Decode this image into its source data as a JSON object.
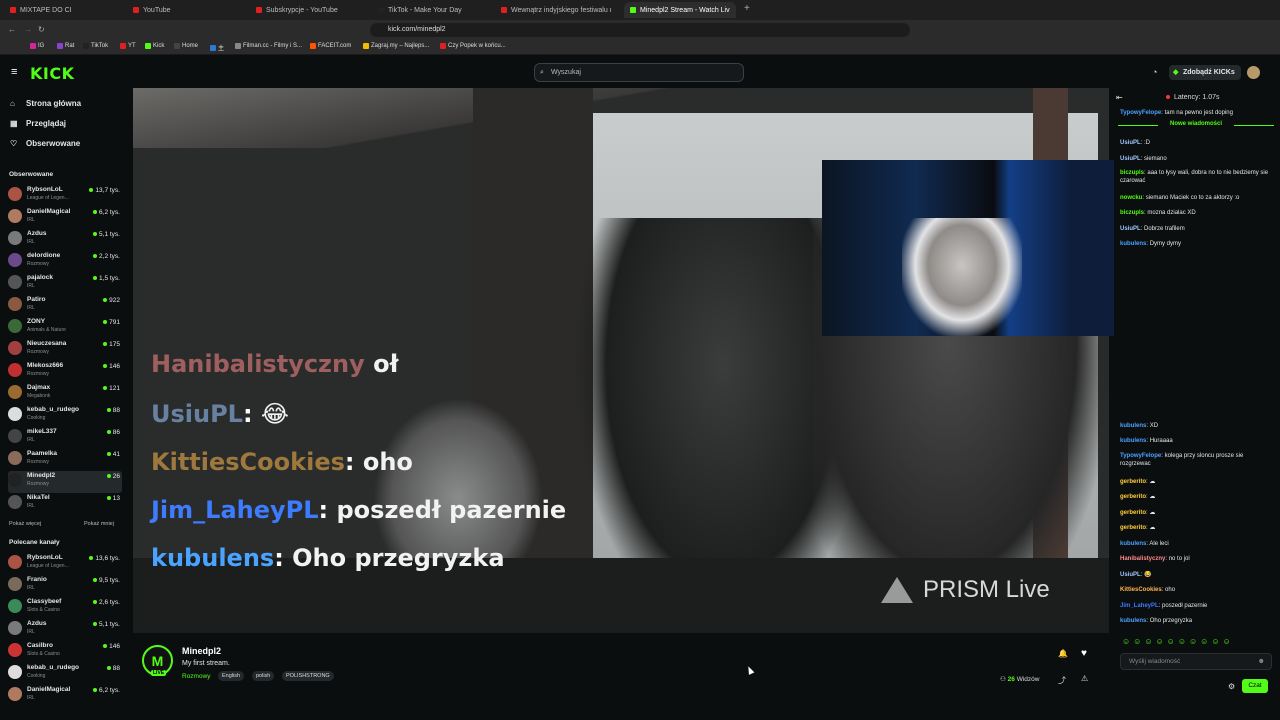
{
  "browser": {
    "tabs": [
      {
        "label": "MIXTAPE DO CI",
        "color": "#e02020"
      },
      {
        "label": "YouTube",
        "color": "#e02020"
      },
      {
        "label": "Subskrypcje - YouTube",
        "color": "#e02020"
      },
      {
        "label": "TikTok - Make Your Day",
        "color": "#222222"
      },
      {
        "label": "Wewnątrz indyjskiego festiwalu rzuc",
        "color": "#e02020"
      },
      {
        "label": "Minedpl2 Stream - Watch Liv",
        "color": "#53fc18"
      }
    ],
    "new_tab": "+",
    "url": "kick.com/minedpl2",
    "bookmarks": [
      {
        "label": "IG",
        "color": "#d6249f"
      },
      {
        "label": "Rat",
        "color": "#8844cc"
      },
      {
        "label": "TikTok",
        "color": "#222222"
      },
      {
        "label": "YT",
        "color": "#e02020"
      },
      {
        "label": "Kick",
        "color": "#53fc18"
      },
      {
        "label": "Home",
        "color": "#444444"
      },
      {
        "label": "主",
        "color": "#2a7ad6"
      },
      {
        "label": "Filman.cc - Filmy i S...",
        "color": "#888888"
      },
      {
        "label": "FACEIT.com",
        "color": "#ff5500"
      },
      {
        "label": "Zagraj.my – Najleps...",
        "color": "#f0c000"
      },
      {
        "label": "Czy Popek w końcu...",
        "color": "#e02020"
      }
    ]
  },
  "kick": {
    "logo": "KICK",
    "search_placeholder": "Wyszukaj",
    "get_kicks": "Zdobądź KICKs"
  },
  "sidebar": {
    "nav": [
      {
        "label": "Strona główna",
        "icon": "home-icon"
      },
      {
        "label": "Przeglądaj",
        "icon": "browse-icon"
      },
      {
        "label": "Obserwowane",
        "icon": "heart-icon"
      }
    ],
    "following_title": "Obserwowane",
    "following": [
      {
        "name": "RybsonLoL",
        "cat": "League of Legen...",
        "viewers": "13,7 tys.",
        "color": "#aa5544"
      },
      {
        "name": "DanielMagical",
        "cat": "IRL",
        "viewers": "6,2 tys.",
        "color": "#b07a60"
      },
      {
        "name": "Azdus",
        "cat": "IRL",
        "viewers": "5,1 tys.",
        "color": "#7a7a7a"
      },
      {
        "name": "delordione",
        "cat": "Rozmowy",
        "viewers": "2,2 tys.",
        "color": "#6a4a8a"
      },
      {
        "name": "pajalock",
        "cat": "IRL",
        "viewers": "1,5 tys.",
        "color": "#555555"
      },
      {
        "name": "Patiro",
        "cat": "IRL",
        "viewers": "922",
        "color": "#8a5a40"
      },
      {
        "name": "ZONY",
        "cat": "Animals & Nature",
        "viewers": "791",
        "color": "#3a6a3a"
      },
      {
        "name": "Nieuczesana",
        "cat": "Rozmowy",
        "viewers": "175",
        "color": "#a04040"
      },
      {
        "name": "Mlekosz666",
        "cat": "Rozmowy",
        "viewers": "146",
        "color": "#c03030"
      },
      {
        "name": "Dajmax",
        "cat": "Megabonk",
        "viewers": "121",
        "color": "#9a6a30"
      },
      {
        "name": "kebab_u_rudego",
        "cat": "Cooking",
        "viewers": "88",
        "color": "#dddddd"
      },
      {
        "name": "mikeL337",
        "cat": "IRL",
        "viewers": "86",
        "color": "#444444"
      },
      {
        "name": "Paamelka",
        "cat": "Rozmowy",
        "viewers": "41",
        "color": "#8a6a5a"
      },
      {
        "name": "Minedpl2",
        "cat": "Rozmowy",
        "viewers": "26",
        "color": "#222222"
      },
      {
        "name": "NikaTel",
        "cat": "IRL",
        "viewers": "13",
        "color": "#555555"
      }
    ],
    "show_more": "Pokaż więcej",
    "show_less": "Pokaż mniej",
    "recommended_title": "Polecane kanały",
    "recommended": [
      {
        "name": "RybsonLoL",
        "cat": "League of Legen...",
        "viewers": "13,6 tys.",
        "color": "#aa5544"
      },
      {
        "name": "Franio",
        "cat": "IRL",
        "viewers": "9,5 tys.",
        "color": "#7a6a5a"
      },
      {
        "name": "Classybeef",
        "cat": "Slots & Casino",
        "viewers": "2,6 tys.",
        "color": "#3a8a5a"
      },
      {
        "name": "Azdus",
        "cat": "IRL",
        "viewers": "5,1 tys.",
        "color": "#7a7a7a"
      },
      {
        "name": "Casilbro",
        "cat": "Slots & Casino",
        "viewers": "146",
        "color": "#cc3333"
      },
      {
        "name": "kebab_u_rudego",
        "cat": "Cooking",
        "viewers": "88",
        "color": "#dddddd"
      },
      {
        "name": "DanielMagical",
        "cat": "IRL",
        "viewers": "6,2 tys.",
        "color": "#b07a60"
      }
    ]
  },
  "video_overlay": [
    {
      "user": "Hanibalistyczny",
      "text": "oł",
      "color": "#ff8a8a"
    },
    {
      "user": "UsiuPL",
      "text": "😂",
      "color": "#9ec7ff"
    },
    {
      "user": "KittiesCookies",
      "text": "oho",
      "color": "#ffb74d"
    },
    {
      "user": "Jim_LaheyPL",
      "text": "poszedł pazernie",
      "color": "#3d7bff"
    },
    {
      "user": "kubulens",
      "text": "Oho przegryzka",
      "color": "#4aa3ff"
    }
  ],
  "prism_logo": "PRISM Live",
  "stream": {
    "avatar_letter": "M",
    "live": "LIVE",
    "streamer": "Minedpl2",
    "title": "My first stream.",
    "category": "Rozmowy",
    "tags": [
      "English",
      "polish",
      "POLISHSTRONG"
    ],
    "viewers_count": "26",
    "viewers_label": "Widzów"
  },
  "chat": {
    "latency": "Latency: 1.07s",
    "new_messages": "Nowe wiadomości",
    "top_message": {
      "user": "TypowyFelope",
      "text": "tam na pewno jest doping"
    },
    "messages_top": [
      {
        "user": "UsiuPL",
        "text": ":D",
        "color": "#9ec7ff"
      },
      {
        "user": "UsiuPL",
        "text": "siemano",
        "color": "#9ec7ff"
      },
      {
        "user": "biczupls",
        "text": "aaa to łysy wali, dobra no to nie bedziemy sie czarować",
        "color": "#53fc18"
      },
      {
        "user": "nowcku",
        "text": "siemano Maciek co to za aktorzy :o",
        "color": "#53fc18"
      },
      {
        "user": "biczupls",
        "text": "mozna dzialac XD",
        "color": "#53fc18"
      },
      {
        "user": "UsiuPL",
        "text": "Dobrze trafilem",
        "color": "#9ec7ff"
      },
      {
        "user": "kubulens",
        "text": "Dymy dymy",
        "color": "#4aa3ff"
      }
    ],
    "messages_bottom": [
      {
        "user": "kubulens",
        "text": "XD",
        "color": "#4aa3ff"
      },
      {
        "user": "kubulens",
        "text": "Huraaaa",
        "color": "#4aa3ff"
      },
      {
        "user": "TypowyFelope",
        "text": "kolega przy sloncu prosze sie rozgrzewac",
        "color": "#4aa3ff"
      },
      {
        "user": "gerberito",
        "text": "☁",
        "color": "#ffcf3d"
      },
      {
        "user": "gerberito",
        "text": "☁",
        "color": "#ffcf3d"
      },
      {
        "user": "gerberito",
        "text": "☁",
        "color": "#ffcf3d"
      },
      {
        "user": "gerberito",
        "text": "☁",
        "color": "#ffcf3d"
      },
      {
        "user": "kubulens",
        "text": "Ale leci",
        "color": "#4aa3ff"
      },
      {
        "user": "Hanibalistyczny",
        "text": "no to jol",
        "color": "#ff8a8a"
      },
      {
        "user": "UsiuPL",
        "text": "😂",
        "color": "#9ec7ff"
      },
      {
        "user": "KittiesCookies",
        "text": "oho",
        "color": "#ffb74d"
      },
      {
        "user": "Jim_LaheyPL",
        "text": "poszedł pazernie",
        "color": "#3d7bff"
      },
      {
        "user": "kubulens",
        "text": "Oho przegryzka",
        "color": "#4aa3ff"
      }
    ],
    "input_placeholder": "Wyślij wiadomość",
    "send_label": "Czat"
  }
}
